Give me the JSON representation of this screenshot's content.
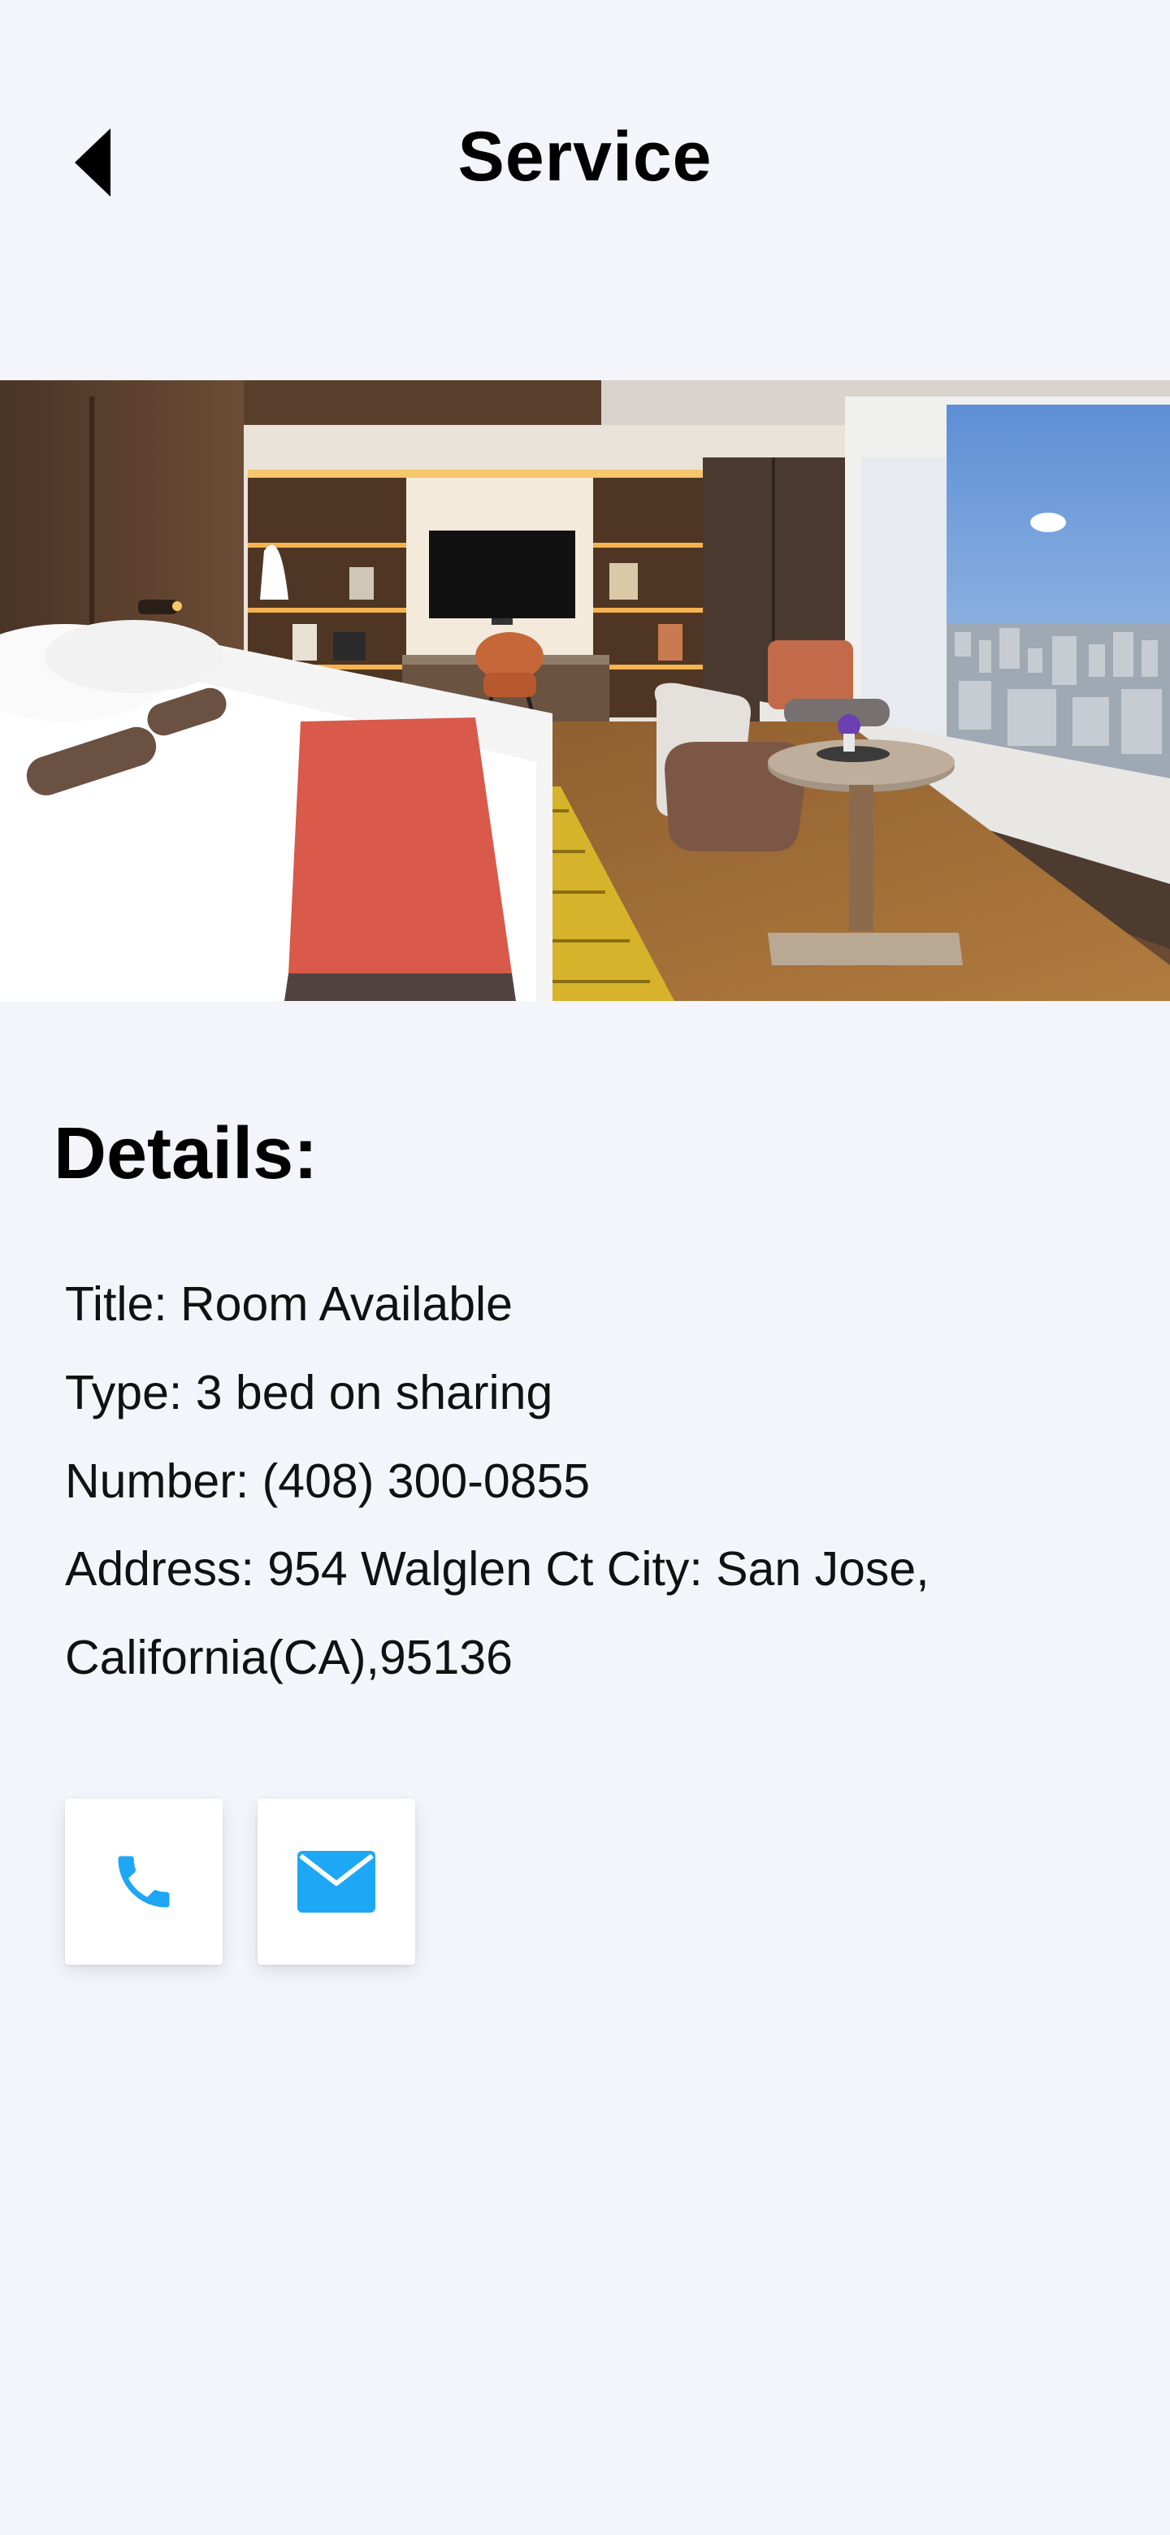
{
  "header": {
    "title": "Service",
    "back_icon": "back-arrow-icon"
  },
  "hero": {
    "image": "hotel-room-photo"
  },
  "details": {
    "heading": "Details:",
    "title_line": "Title: Room Available",
    "type_line": "Type: 3 bed on sharing",
    "number_line": "Number: (408) 300-0855",
    "address_line1": "Address: 954 Walglen Ct City: San Jose,",
    "address_line2": "California(CA),95136"
  },
  "actions": {
    "call_icon": "phone-icon",
    "mail_icon": "mail-icon",
    "accent_color": "#1ea7f5"
  }
}
